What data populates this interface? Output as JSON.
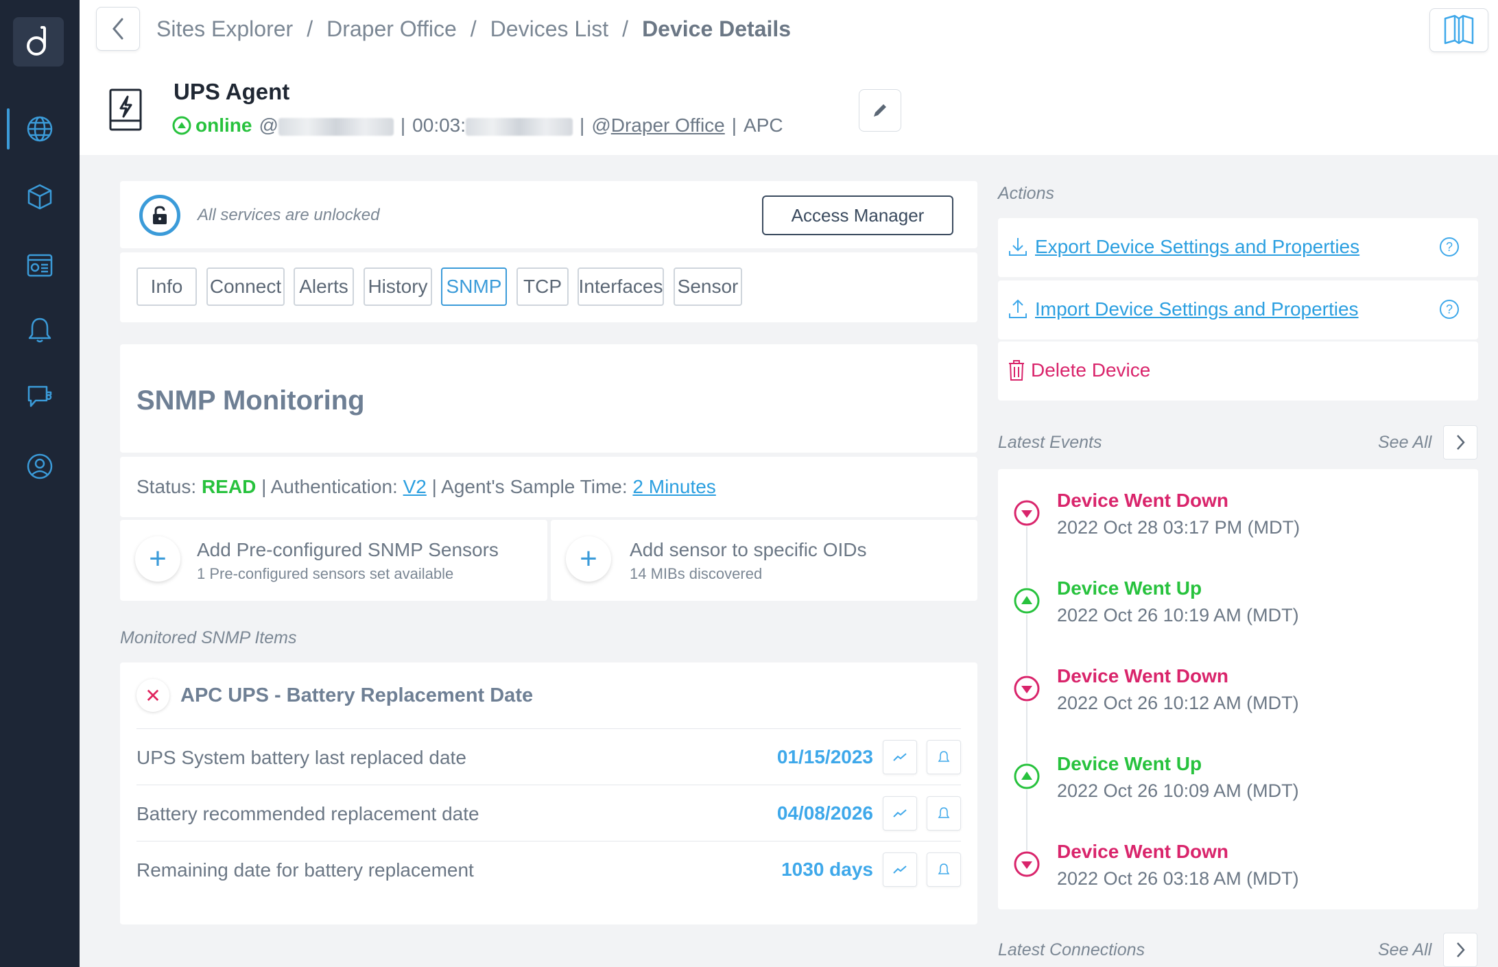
{
  "breadcrumb": {
    "items": [
      "Sites Explorer",
      "Draper Office",
      "Devices List"
    ],
    "separator": "/",
    "current": "Device Details"
  },
  "device": {
    "name": "UPS Agent",
    "status": "online",
    "ip_prefix": "@",
    "mac_prefix": "00:03:",
    "site_prefix": "@",
    "site": "Draper Office",
    "vendor": "APC",
    "divider": "|"
  },
  "lock": {
    "text": "All services are unlocked",
    "button": "Access Manager"
  },
  "tabs": [
    "Info",
    "Connect",
    "Alerts",
    "History",
    "SNMP",
    "TCP",
    "Interfaces",
    "Sensor"
  ],
  "active_tab": "SNMP",
  "snmp": {
    "title": "SNMP Monitoring",
    "status_label": "Status:",
    "status_value": "READ",
    "auth_label": "| Authentication:",
    "auth_value": "V2",
    "sample_label": "| Agent's Sample Time:",
    "sample_value": "2 Minutes",
    "preconfigured": {
      "title": "Add Pre-configured SNMP Sensors",
      "subtitle": "1 Pre-configured sensors set available"
    },
    "oids": {
      "title": "Add sensor to specific OIDs",
      "subtitle": "14 MIBs discovered"
    }
  },
  "monitored": {
    "label": "Monitored SNMP Items",
    "group_title": "APC UPS - Battery Replacement Date",
    "rows": [
      {
        "label": "UPS System battery last replaced date",
        "value": "01/15/2023"
      },
      {
        "label": "Battery recommended replacement date",
        "value": "04/08/2026"
      },
      {
        "label": "Remaining date for battery replacement",
        "value": "1030 days"
      }
    ]
  },
  "actions": {
    "label": "Actions",
    "export": "Export Device Settings and Properties",
    "import": "Import Device Settings and Properties",
    "delete": "Delete Device",
    "help": "?"
  },
  "events": {
    "label": "Latest Events",
    "see_all": "See All",
    "items": [
      {
        "title": "Device Went Down",
        "time": "2022 Oct 28 03:17 PM (MDT)",
        "type": "down"
      },
      {
        "title": "Device Went Up",
        "time": "2022 Oct 26 10:19 AM (MDT)",
        "type": "up"
      },
      {
        "title": "Device Went Down",
        "time": "2022 Oct 26 10:12 AM (MDT)",
        "type": "down"
      },
      {
        "title": "Device Went Up",
        "time": "2022 Oct 26 10:09 AM (MDT)",
        "type": "up"
      },
      {
        "title": "Device Went Down",
        "time": "2022 Oct 26 03:18 AM (MDT)",
        "type": "down"
      }
    ]
  },
  "connections": {
    "label": "Latest Connections",
    "see_all": "See All"
  },
  "colors": {
    "accent": "#3b9bd9",
    "online": "#27c23d",
    "danger": "#d9246b",
    "sidebar": "#1d2636"
  },
  "icons": {
    "sidebar": [
      "globe-icon",
      "cube-icon",
      "dashboard-icon",
      "bell-icon",
      "chat-icon",
      "support-icon"
    ]
  }
}
